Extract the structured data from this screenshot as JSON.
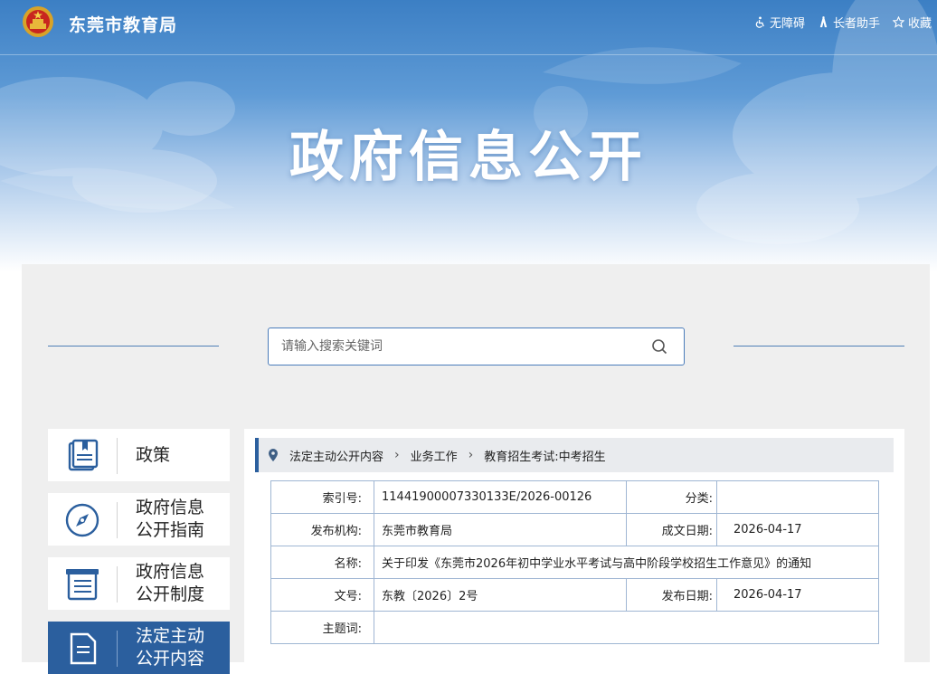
{
  "header": {
    "site_name": "东莞市教育局",
    "links": [
      {
        "icon": "accessibility-icon",
        "label": "无障碍"
      },
      {
        "icon": "elder-assist-icon",
        "label": "长者助手"
      },
      {
        "icon": "star-icon",
        "label": "收藏"
      }
    ]
  },
  "banner": {
    "title": "政府信息公开"
  },
  "search": {
    "placeholder": "请输入搜索关键词"
  },
  "nav": {
    "items": [
      {
        "icon": "book-icon",
        "label": "政策",
        "active": false
      },
      {
        "icon": "compass-icon",
        "label": "政府信息\n公开指南",
        "active": false
      },
      {
        "icon": "list-document-icon",
        "label": "政府信息\n公开制度",
        "active": false
      },
      {
        "icon": "document-icon",
        "label": "法定主动\n公开内容",
        "active": true
      }
    ]
  },
  "breadcrumb": [
    "法定主动公开内容",
    "业务工作",
    "教育招生考试:中考招生"
  ],
  "info": {
    "index_label": "索引号:",
    "index_value": "11441900007330133E/2026-00126",
    "category_label": "分类:",
    "category_value": "",
    "publisher_label": "发布机构:",
    "publisher_value": "东莞市教育局",
    "created_label": "成文日期:",
    "created_value": "2026-04-17",
    "name_label": "名称:",
    "name_value": "关于印发《东莞市2026年初中学业水平考试与高中阶段学校招生工作意见》的通知",
    "docno_label": "文号:",
    "docno_value": "东教〔2026〕2号",
    "published_label": "发布日期:",
    "published_value": "2026-04-17",
    "subject_label": "主题词:",
    "subject_value": ""
  },
  "colors": {
    "primary": "#2b5f9e",
    "banner_top": "#3c7fc4",
    "panel_bg": "#efefef"
  }
}
